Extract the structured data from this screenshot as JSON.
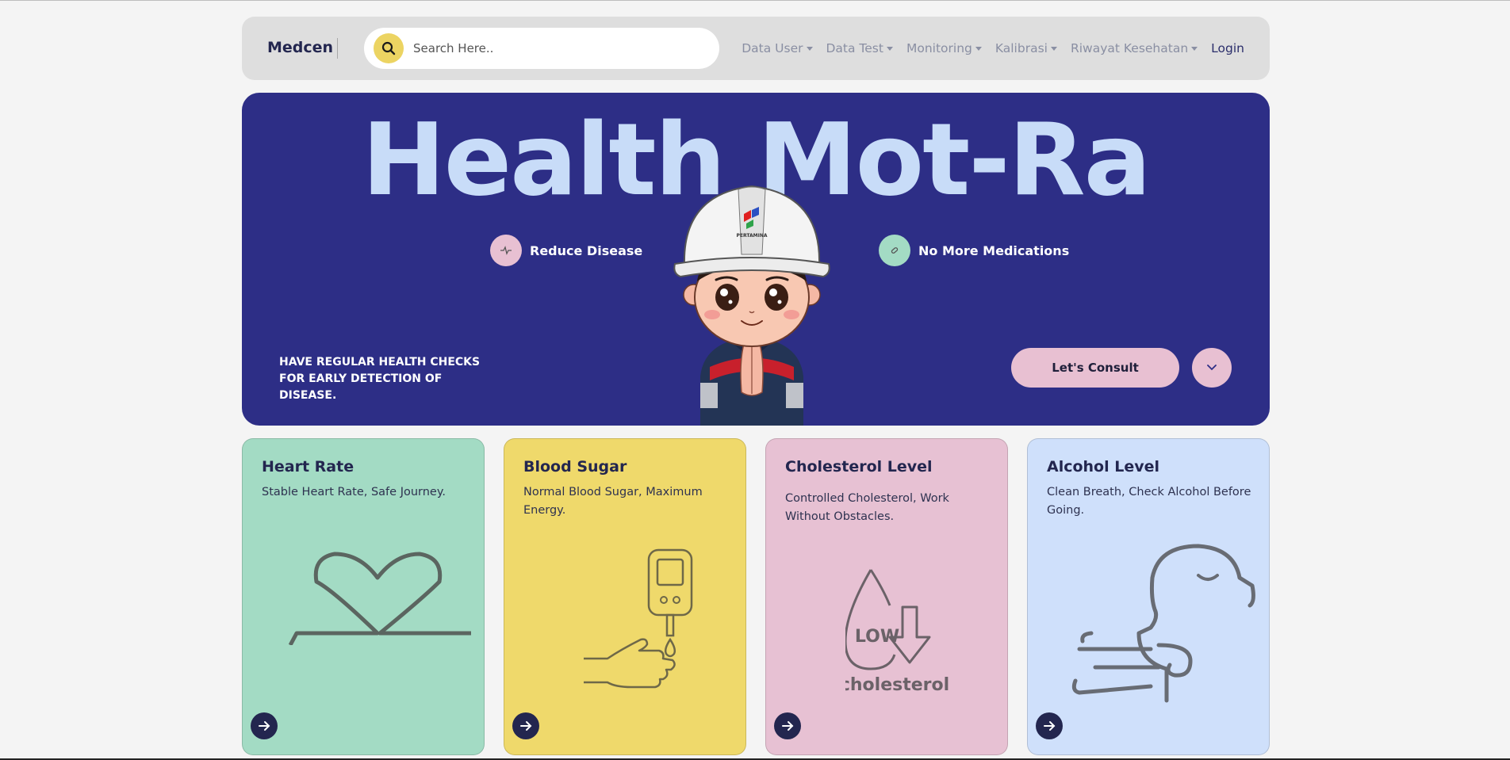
{
  "navbar": {
    "brand": "Medcen",
    "search_placeholder": "Search Here..",
    "menu": [
      {
        "label": "Data User"
      },
      {
        "label": "Data Test"
      },
      {
        "label": "Monitoring"
      },
      {
        "label": "Kalibrasi"
      },
      {
        "label": "Riwayat Kesehatan"
      }
    ],
    "login_label": "Login"
  },
  "hero": {
    "title": "Health Mot-Ra",
    "feature_left": "Reduce Disease",
    "feature_right": "No More Medications",
    "tagline": "HAVE REGULAR HEALTH CHECKS FOR EARLY DETECTION OF DISEASE.",
    "consult_label": "Let's Consult",
    "helmet_logo_text": "PERTAMINA"
  },
  "cards": [
    {
      "title": "Heart Rate",
      "description": "Stable Heart Rate, Safe Journey.",
      "color": "#a3dbc4",
      "icon": "heart-line-icon"
    },
    {
      "title": "Blood Sugar",
      "description": "Normal Blood Sugar, Maximum Energy.",
      "color": "#efd96b",
      "icon": "glucometer-icon"
    },
    {
      "title": "Cholesterol Level",
      "description": "Controlled Cholesterol, Work Without Obstacles.",
      "color": "#e7c1d3",
      "icon": "low-cholesterol-icon",
      "art_top": "LOW",
      "art_bottom": "cholesterol"
    },
    {
      "title": "Alcohol Level",
      "description": "Clean Breath, Check Alcohol Before Going.",
      "color": "#cfe0fb",
      "icon": "breath-icon"
    }
  ],
  "colors": {
    "hero_bg": "#2d2e86",
    "hero_title": "#c8dcf8",
    "accent_yellow": "#ecd462",
    "accent_pink": "#e8c0d2",
    "dark_navy": "#23264f"
  }
}
